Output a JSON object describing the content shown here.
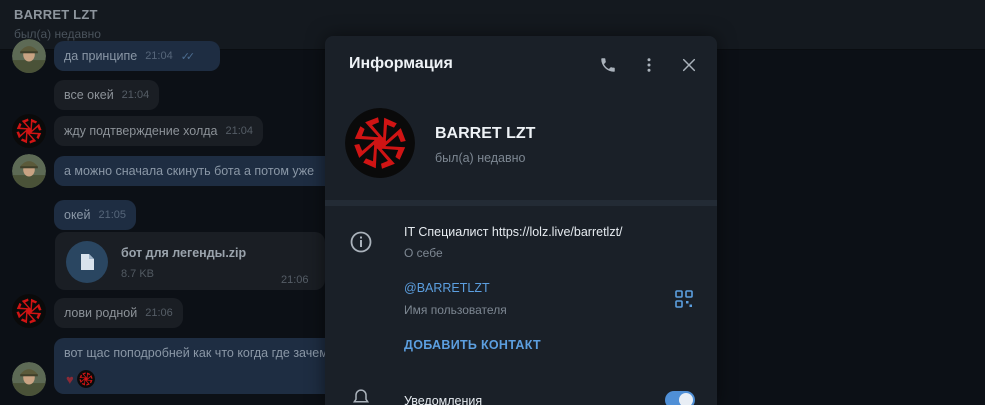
{
  "chat": {
    "name": "BARRET LZT",
    "status": "был(а) недавно"
  },
  "messages": [
    {
      "text": "да принципе",
      "time": "21:04"
    },
    {
      "text": "все окей",
      "time": "21:04"
    },
    {
      "text": "жду подтверждение холда",
      "time": "21:04"
    },
    {
      "text": "а можно сначала скинуть бота а потом уже"
    },
    {
      "text": "окей",
      "time": "21:05"
    },
    {
      "text": "лови родной",
      "time": "21:06"
    },
    {
      "text": "вот щас поподробней как что когда где зачем"
    }
  ],
  "file": {
    "name": "бот для легенды.zip",
    "size": "8.7 KB",
    "time": "21:06"
  },
  "emoji": {
    "heart": "♥"
  },
  "panel": {
    "title": "Информация",
    "name": "BARRET LZT",
    "status": "был(а) недавно",
    "bio": "IT Специалист https://lolz.live/barretlzt/",
    "bio_label": "О себе",
    "username": "@BARRETLZT",
    "username_label": "Имя пользователя",
    "add_contact": "ДОБАВИТЬ КОНТАКТ",
    "notifications_label": "Уведомления",
    "notifications_on": true
  },
  "colors": {
    "accent": "#5c9fe0",
    "symbol": "#d01414",
    "panel_bg": "#1a2028",
    "toggle": "#4f8fd6"
  }
}
